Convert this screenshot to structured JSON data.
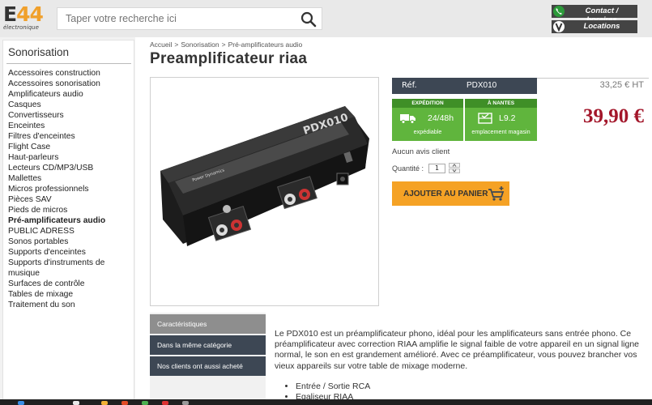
{
  "header": {
    "logo": {
      "brand": "E44",
      "brand_letter": "E",
      "brand_number": "44",
      "tagline": "électronique"
    },
    "search": {
      "placeholder": "Taper votre recherche ici"
    },
    "contact_label": "Contact / horaires",
    "locations_label": "Locations"
  },
  "sidebar": {
    "title": "Sonorisation",
    "items": [
      {
        "label": "Accessoires construction"
      },
      {
        "label": "Accessoires sonorisation"
      },
      {
        "label": "Amplificateurs audio"
      },
      {
        "label": "Casques"
      },
      {
        "label": "Convertisseurs"
      },
      {
        "label": "Enceintes"
      },
      {
        "label": "Filtres d'enceintes"
      },
      {
        "label": "Flight Case"
      },
      {
        "label": "Haut-parleurs"
      },
      {
        "label": "Lecteurs CD/MP3/USB"
      },
      {
        "label": "Mallettes"
      },
      {
        "label": "Micros professionnels"
      },
      {
        "label": "Pièces SAV"
      },
      {
        "label": "Pieds de micros"
      },
      {
        "label": "Pré-amplificateurs audio",
        "active": true
      },
      {
        "label": "PUBLIC ADRESS"
      },
      {
        "label": "Sonos portables"
      },
      {
        "label": "Supports d'enceintes"
      },
      {
        "label": "Supports d'instruments de"
      },
      {
        "label": "musique"
      },
      {
        "label": "Surfaces de contrôle"
      },
      {
        "label": "Tables de mixage"
      },
      {
        "label": "Traitement du son"
      }
    ]
  },
  "breadcrumb": [
    "Accueil",
    ">",
    "Sonorisation",
    ">",
    "Pré-amplificateurs audio"
  ],
  "product": {
    "title": "Preamplificateur riaa",
    "ref_label": "Réf.",
    "ref_value": "PDX010",
    "price_ht": "33,25 € HT",
    "price": "39,90 €",
    "expedition": {
      "header": "EXPÉDITION",
      "value": "24/48h",
      "sub": "expédiable"
    },
    "nantes": {
      "header": "À NANTES",
      "value": "L9.2",
      "sub": "emplacement magasin"
    },
    "reviews": "Aucun avis client",
    "quantity_label": "Quantité :",
    "quantity": "1",
    "add_to_cart": "AJOUTER AU PANIER",
    "image_panel_text": "PDX010",
    "image_brand_text": "Power Dynamics"
  },
  "tabs": [
    {
      "label": "Caractéristiques",
      "active": true
    },
    {
      "label": "Dans la même catégorie"
    },
    {
      "label": "Nos clients ont aussi acheté"
    }
  ],
  "description": {
    "text": "Le PDX010 est un préamplificateur phono, idéal pour les amplificateurs sans entrée phono. Ce préamplificateur avec correction RIAA amplifie le signal faible de votre appareil en un signal ligne normal, le son en est grandement amélioré. Avec ce préamplificateur, vous pouvez brancher vos vieux appareils sur votre table de mixage moderne.",
    "features": [
      "Entrée / Sortie RCA",
      "Egaliseur RIAA"
    ]
  },
  "colors": {
    "accent_orange": "#f5a225",
    "price_red": "#a3162a",
    "dark_bar": "#3d4754",
    "stock_green": "#60b53d"
  }
}
